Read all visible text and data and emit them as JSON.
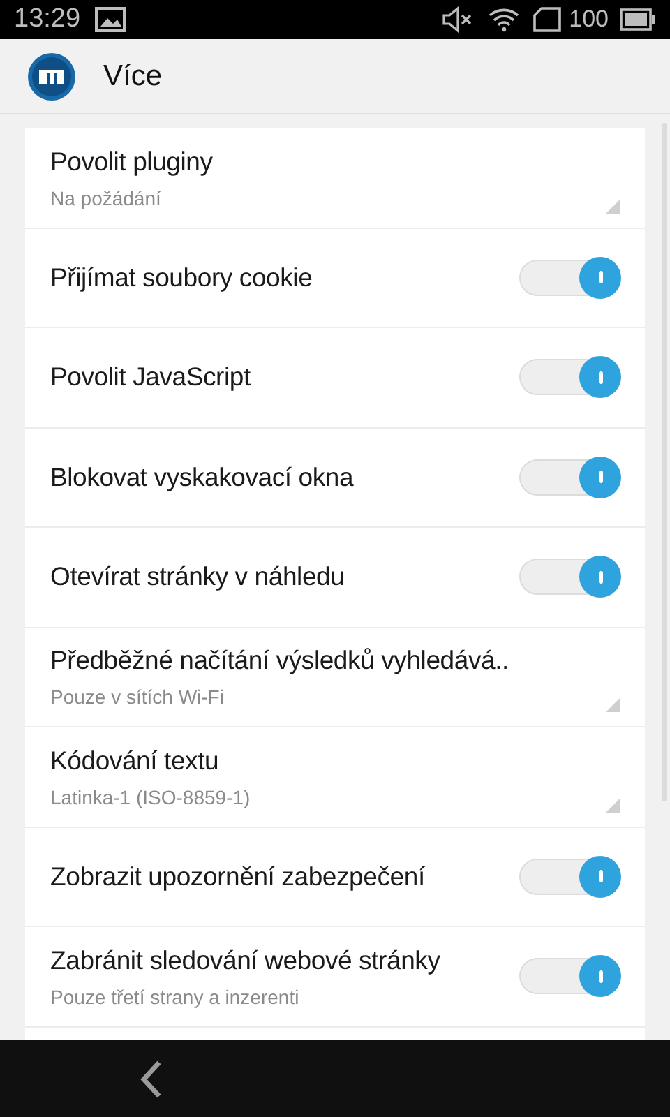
{
  "status_bar": {
    "time": "13:29",
    "battery": "100"
  },
  "app_bar": {
    "title": "Více"
  },
  "settings": [
    {
      "kind": "list",
      "title": "Povolit pluginy",
      "summary": "Na požádání"
    },
    {
      "kind": "toggle",
      "title": "Přijímat soubory cookie",
      "on": true
    },
    {
      "kind": "toggle",
      "title": "Povolit JavaScript",
      "on": true
    },
    {
      "kind": "toggle",
      "title": "Blokovat vyskakovací okna",
      "on": true
    },
    {
      "kind": "toggle",
      "title": "Otevírat stránky v náhledu",
      "on": true
    },
    {
      "kind": "list",
      "title": "Předběžné načítání výsledků vyhledává..",
      "summary": "Pouze v sítích Wi-Fi"
    },
    {
      "kind": "list",
      "title": "Kódování textu",
      "summary": "Latinka-1 (ISO-8859-1)"
    },
    {
      "kind": "toggle",
      "title": "Zobrazit upozornění zabezpečení",
      "on": true
    },
    {
      "kind": "toggle",
      "title": "Zabránit sledování webové stránky",
      "summary": "Pouze třetí strany a inzerenti",
      "on": true
    }
  ]
}
